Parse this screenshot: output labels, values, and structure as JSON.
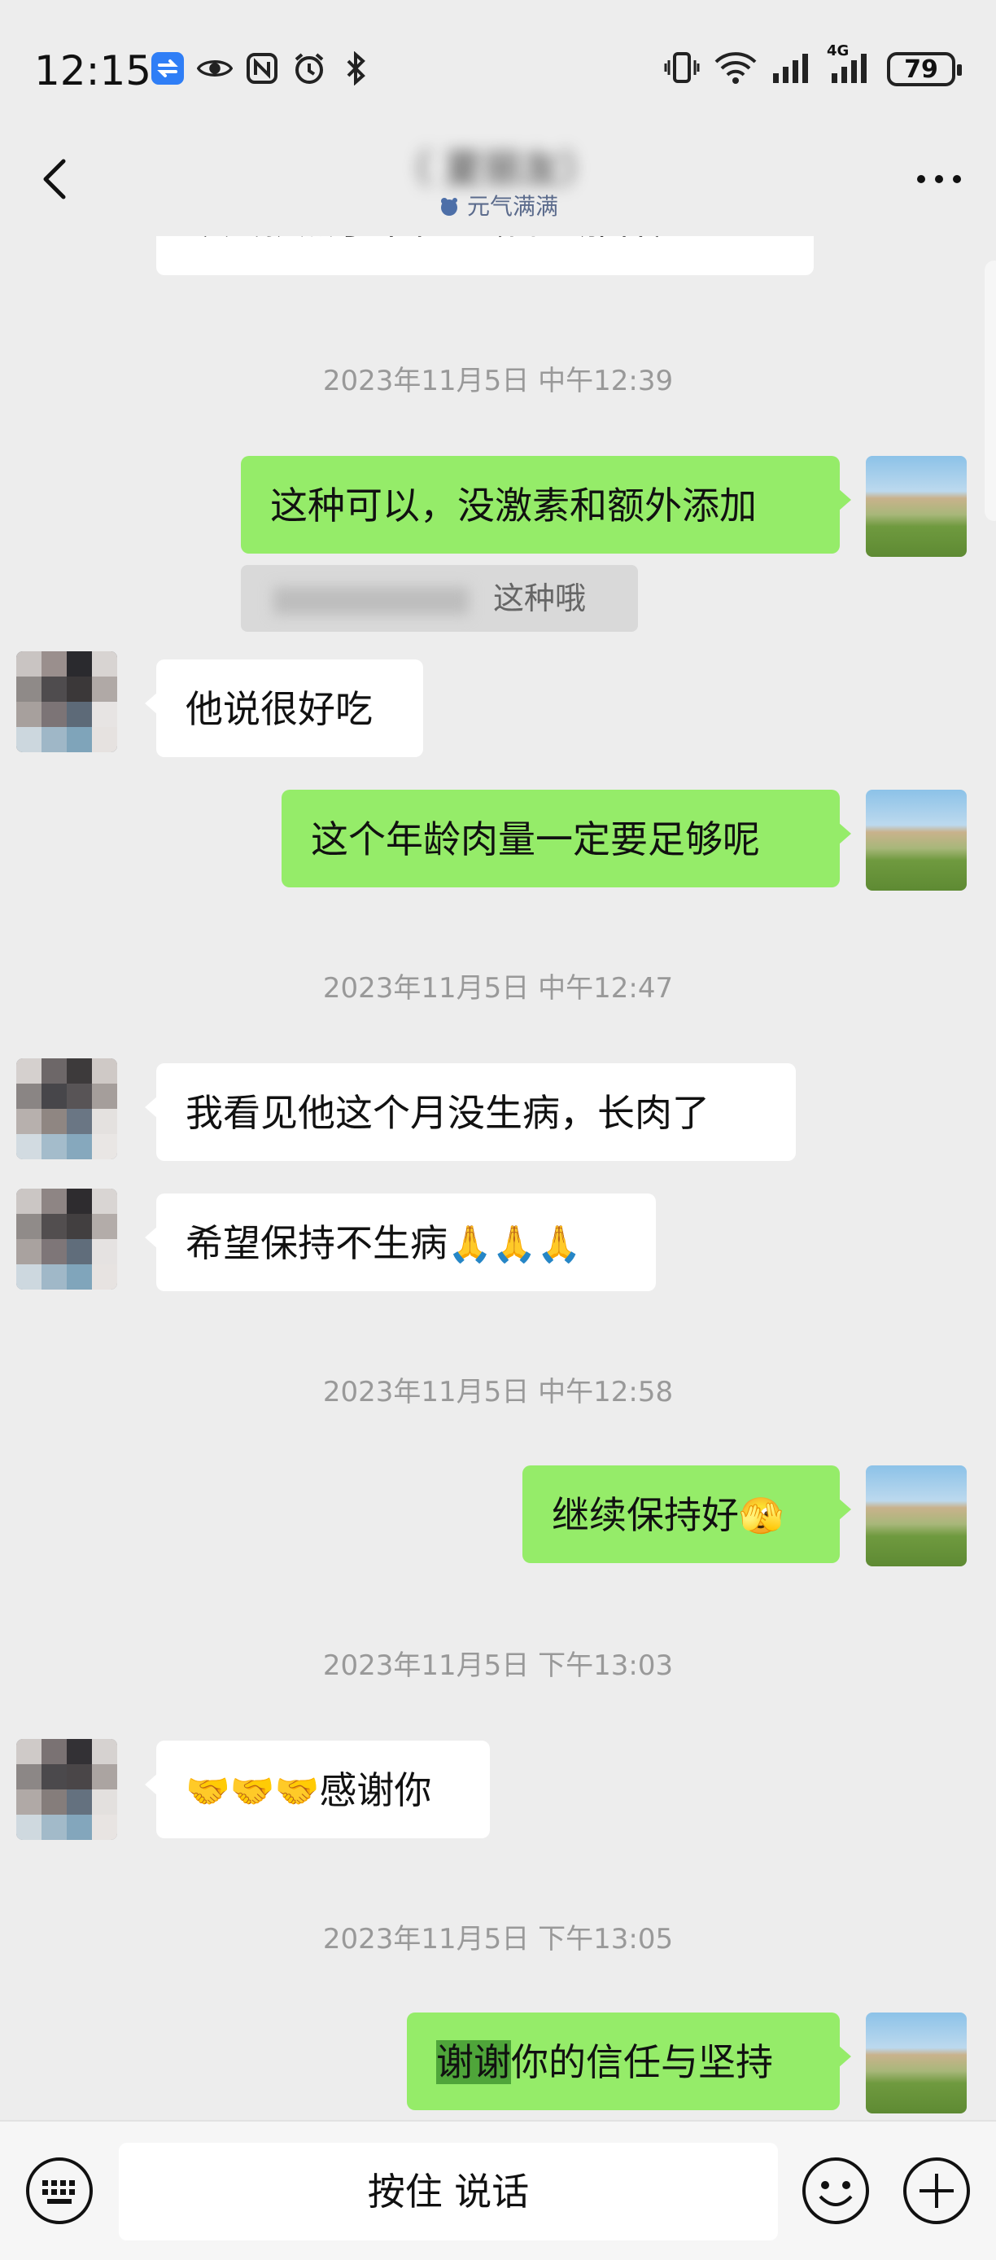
{
  "status_bar": {
    "time": "12:15",
    "network": "4G",
    "battery": "79",
    "icons": [
      "swap-app-icon",
      "eye-icon",
      "nfc-icon",
      "alarm-icon",
      "bluetooth-icon",
      "vibrate-icon",
      "wifi-icon",
      "signal-icon",
      "signal-4g-icon",
      "battery-icon"
    ]
  },
  "header": {
    "title": "（ 夏丽友）",
    "subtitle": "元气满满",
    "back_icon": "chevron-left-icon",
    "more_icon": "more-icon"
  },
  "chat": {
    "partial_message": "今天就煮了菜花。（日色那样）",
    "timestamps": [
      "2023年11月5日 中午12:39",
      "2023年11月5日 中午12:47",
      "2023年11月5日 中午12:58",
      "2023年11月5日 下午13:03",
      "2023年11月5日 下午13:05"
    ],
    "messages": [
      {
        "from": "me",
        "text": "这种可以，没激素和额外添加"
      },
      {
        "from": "me",
        "quote": "这种哦"
      },
      {
        "from": "peer",
        "text": "他说很好吃"
      },
      {
        "from": "me",
        "text": "这个年龄肉量一定要足够呢"
      },
      {
        "from": "peer",
        "text": "我看见他这个月没生病，长肉了"
      },
      {
        "from": "peer",
        "text": "希望保持不生病",
        "emoji": "🙏🙏🙏"
      },
      {
        "from": "me",
        "text": "继续保持好",
        "emoji": "🫣"
      },
      {
        "from": "peer",
        "emoji": "🤝🤝🤝",
        "text": "感谢你"
      },
      {
        "from": "me",
        "highlight": "谢谢",
        "text": "你的信任与坚持"
      }
    ]
  },
  "input_bar": {
    "voice_label": "按住 说话",
    "icons": [
      "keyboard-icon",
      "emoji-icon",
      "plus-icon"
    ]
  }
}
